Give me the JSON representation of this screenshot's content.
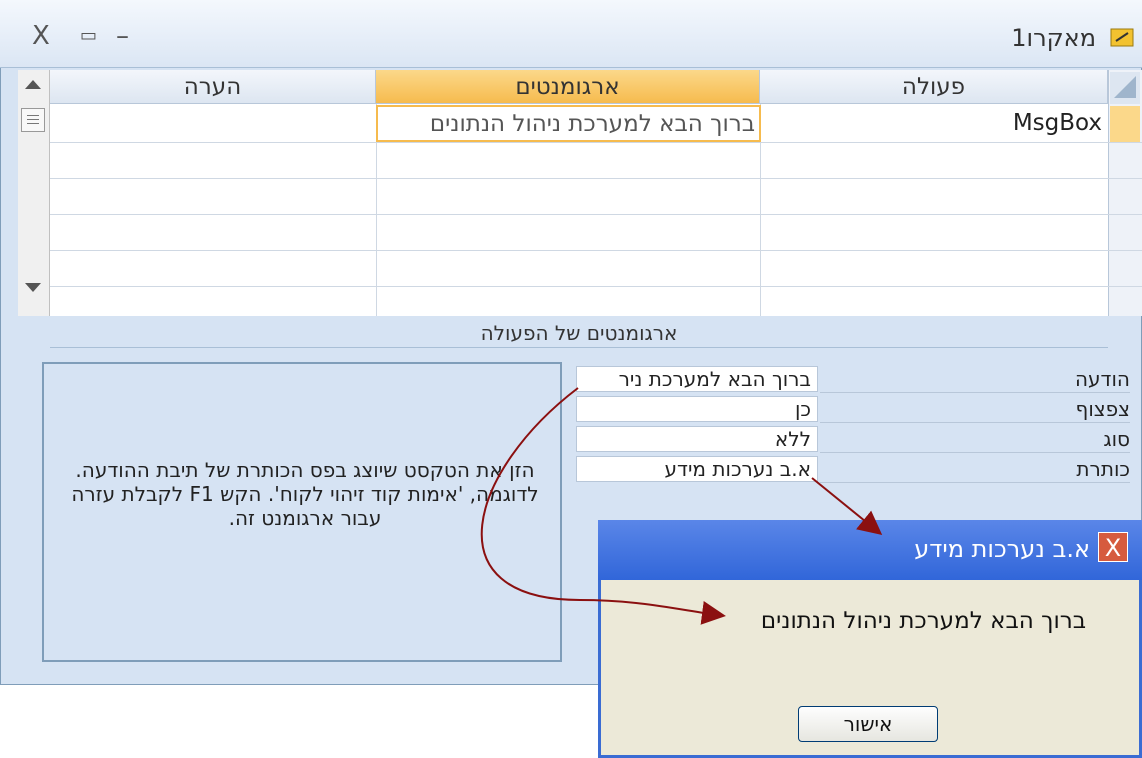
{
  "window": {
    "title": "מאקרו1",
    "ctl_close": "X",
    "ctl_restore": "▭",
    "ctl_min": "–"
  },
  "grid": {
    "columns": {
      "action": "פעולה",
      "arguments": "ארגומנטים",
      "comment": "הערה"
    },
    "rows": [
      {
        "action": "MsgBox",
        "arguments": "ברוך הבא למערכת ניהול הנתונים",
        "comment": ""
      }
    ]
  },
  "args_section": {
    "title": "ארגומנטים של הפעולה",
    "properties": [
      {
        "label": "הודעה",
        "value": "ברוך הבא למערכת ניר"
      },
      {
        "label": "צפצוף",
        "value": "כן"
      },
      {
        "label": "סוג",
        "value": "ללא"
      },
      {
        "label": "כותרת",
        "value": "א.ב נערכות מידע"
      }
    ],
    "help_text": "הזן את הטקסט שיוצג בפס הכותרת של תיבת ההודעה. לדוגמה, 'אימות קוד זיהוי לקוח'. הקש F1 לקבלת עזרה עבור ארגומנט זה."
  },
  "msgbox": {
    "title": "א.ב נערכות מידע",
    "close": "X",
    "message": "ברוך הבא למערכת ניהול הנתונים",
    "ok_label": "אישור"
  },
  "colors": {
    "annotation_arrow": "#8b1010",
    "active_header": "#f6bb4e",
    "dialog_title": "#3166d9"
  }
}
